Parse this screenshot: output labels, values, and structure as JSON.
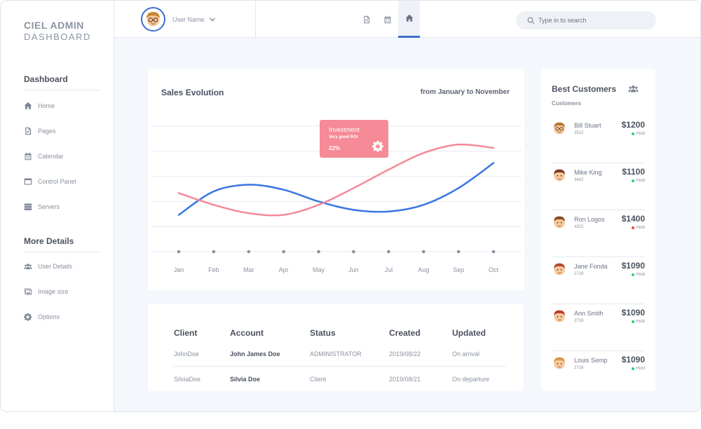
{
  "brand": {
    "line1": "CIEL ADMIN",
    "line2": "DASHBOARD"
  },
  "sidebar": {
    "sections": [
      {
        "heading": "Dashboard",
        "items": [
          {
            "label": "Home",
            "icon": "home-icon"
          },
          {
            "label": "Pages",
            "icon": "page-icon"
          },
          {
            "label": "Calendar",
            "icon": "calendar-icon"
          },
          {
            "label": "Control Panel",
            "icon": "window-icon"
          },
          {
            "label": "Servers",
            "icon": "server-icon"
          }
        ]
      },
      {
        "heading": "More Details",
        "items": [
          {
            "label": "User Details",
            "icon": "users-icon"
          },
          {
            "label": "Image size",
            "icon": "image-icon"
          },
          {
            "label": "Options",
            "icon": "gear-icon"
          }
        ]
      }
    ]
  },
  "topbar": {
    "user_name": "User Name",
    "icons": [
      "page-icon",
      "calendar-icon",
      "home-icon"
    ],
    "active_icon": "home-icon",
    "search_placeholder": "Type in to search"
  },
  "sales_chart": {
    "title": "Sales Evolution",
    "range_label": "from January to November",
    "tooltip": {
      "title": "Investment",
      "subtitle": "Very good ROI",
      "value": "22%"
    }
  },
  "chart_data": {
    "type": "line",
    "categories": [
      "Jan",
      "Feb",
      "Mar",
      "Apr",
      "May",
      "Jun",
      "Jul",
      "Aug",
      "Sep",
      "Oct"
    ],
    "series": [
      {
        "color": "#3b75e3",
        "values": [
          2.2,
          3.6,
          4.0,
          3.7,
          3.0,
          2.5,
          2.4,
          2.8,
          3.8,
          5.3
        ]
      },
      {
        "color": "#f4899a",
        "values": [
          3.5,
          2.8,
          2.3,
          2.2,
          2.8,
          3.8,
          4.9,
          5.9,
          6.4,
          6.2
        ]
      }
    ],
    "ylim": [
      0,
      7.5
    ],
    "grid": true,
    "xlabel": "",
    "ylabel": ""
  },
  "table": {
    "headers": [
      "Client",
      "Account",
      "Status",
      "Created",
      "Updated"
    ],
    "rows": [
      [
        "JohnDoe",
        "John James Doe",
        "ADMINISTRATOR",
        "2019/08/22",
        "On arrival"
      ],
      [
        "SilviaDoe",
        "Silvia Doe",
        "Client",
        "2019/08/21",
        "On departure"
      ]
    ]
  },
  "customers": {
    "title": "Best Customers",
    "subtitle": "Customers",
    "list": [
      {
        "name": "Bill Stuart",
        "id": "3512",
        "amount": "$1200",
        "status": "Hold",
        "status_color": "#2ecc71",
        "hair": "#b9772f",
        "glasses": true
      },
      {
        "name": "Mike King",
        "id": "3442",
        "amount": "$1100",
        "status": "Hold",
        "status_color": "#2ecc71",
        "hair": "#7a3a1e",
        "glasses": false
      },
      {
        "name": "Ron Logos",
        "id": "4322",
        "amount": "$1400",
        "status": "Hold",
        "status_color": "#e74c3c",
        "hair": "#8a4a22",
        "glasses": false
      },
      {
        "name": "Jane Fonda",
        "id": "2718",
        "amount": "$1090",
        "status": "Hold",
        "status_color": "#2ecc71",
        "hair": "#b5482d",
        "glasses": false
      },
      {
        "name": "Ann Smith",
        "id": "2718",
        "amount": "$1090",
        "status": "Hold",
        "status_color": "#2ecc71",
        "hair": "#c0392b",
        "glasses": false
      },
      {
        "name": "Louis Semp",
        "id": "2718",
        "amount": "$1090",
        "status": "Hold",
        "status_color": "#2ecc71",
        "hair": "#d69a4a",
        "glasses": false
      }
    ]
  }
}
